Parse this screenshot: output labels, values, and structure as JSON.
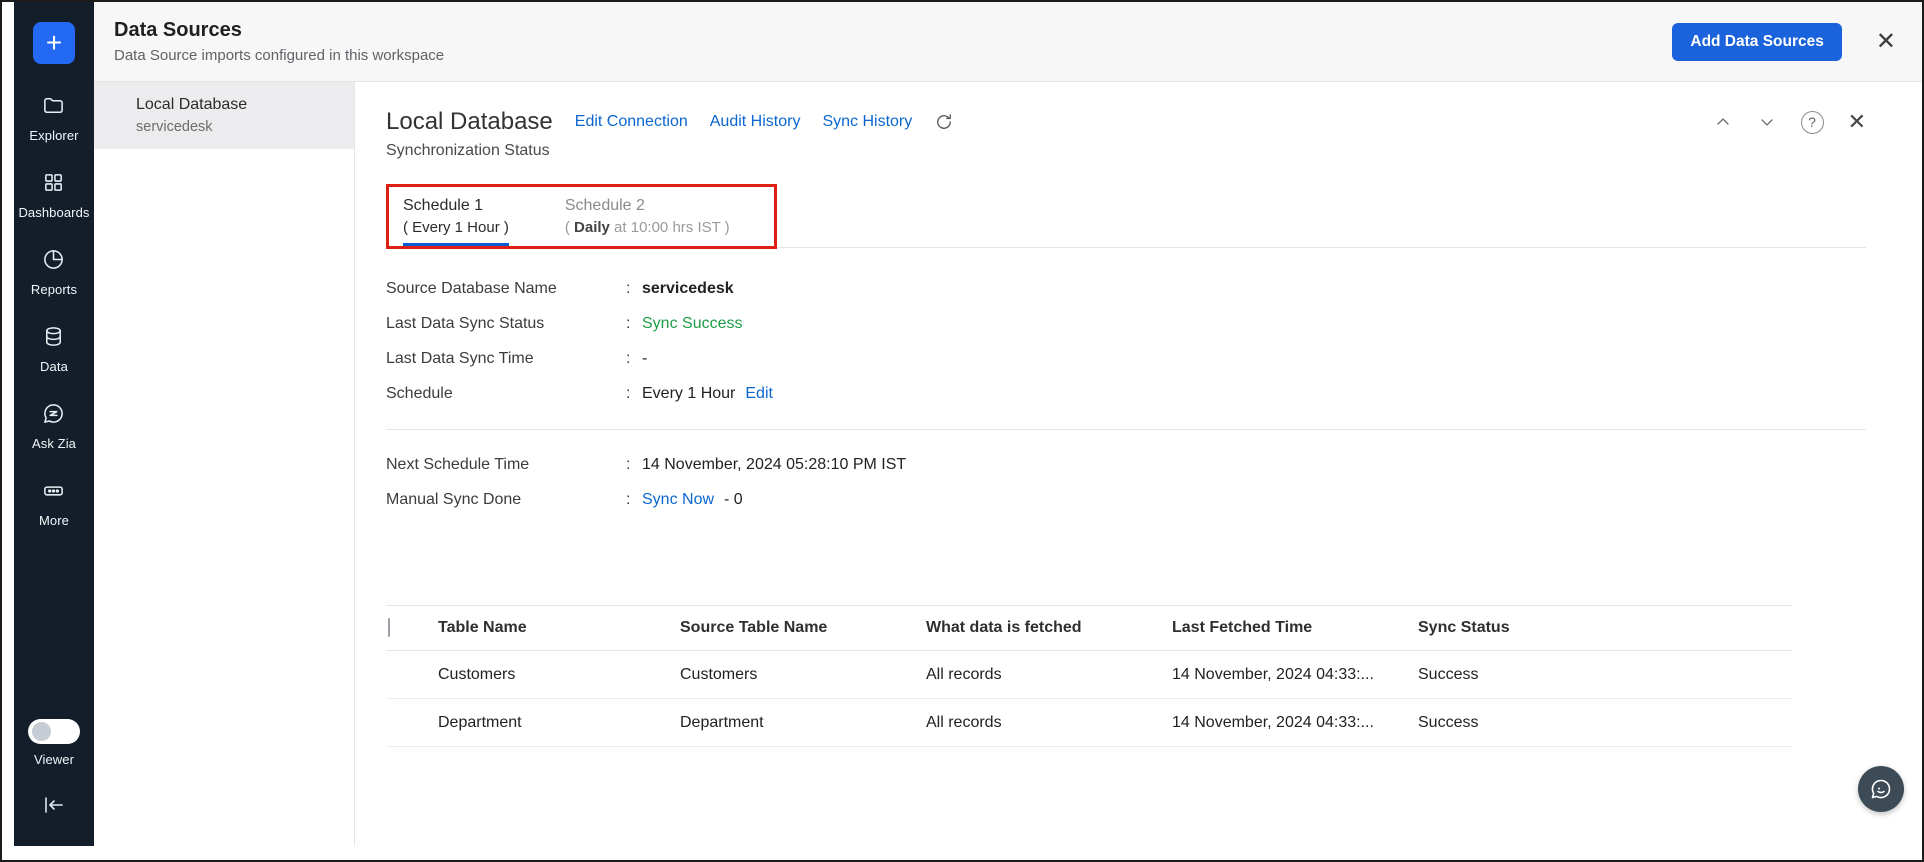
{
  "colors": {
    "accent_blue": "#1a63dc",
    "link_blue": "#0b66d0",
    "success_green": "#1f9d46",
    "annotation_red": "#dd1f14",
    "sidebar_bg": "#141e2a"
  },
  "sidebar": {
    "plus_label": "+",
    "items": [
      {
        "label": "Explorer",
        "icon": "folder-icon"
      },
      {
        "label": "Dashboards",
        "icon": "grid-icon"
      },
      {
        "label": "Reports",
        "icon": "pie-chart-icon"
      },
      {
        "label": "Data",
        "icon": "database-icon"
      },
      {
        "label": "Ask Zia",
        "icon": "zia-chat-icon"
      },
      {
        "label": "More",
        "icon": "ellipsis-icon"
      }
    ],
    "viewer_label": "Viewer"
  },
  "header": {
    "title": "Data Sources",
    "subtitle": "Data Source imports configured in this workspace",
    "add_button_label": "Add Data Sources",
    "close_icon": "✕"
  },
  "source_list": {
    "selected": {
      "name": "Local Database",
      "sub": "servicedesk"
    }
  },
  "main": {
    "title": "Local Database",
    "links": [
      "Edit Connection",
      "Audit History",
      "Sync History"
    ],
    "section_subtitle": "Synchronization Status",
    "help_icon": "?",
    "close_icon": "✕",
    "tabs": {
      "tab1": {
        "title": "Schedule 1",
        "sub": "( Every 1 Hour )"
      },
      "tab2": {
        "title": "Schedule 2",
        "sub_prefix": "( ",
        "sub_bold": "Daily",
        "sub_rest": " at 10:00 hrs IST )"
      }
    },
    "fields": {
      "colon": ":",
      "source_db": {
        "label": "Source Database Name",
        "value": "servicedesk"
      },
      "sync_status": {
        "label": "Last Data Sync Status",
        "value": "Sync Success"
      },
      "sync_time": {
        "label": "Last Data Sync Time",
        "value": "-"
      },
      "schedule": {
        "label": "Schedule",
        "value": "Every 1 Hour",
        "edit_link": "Edit"
      },
      "next_schedule": {
        "label": "Next Schedule Time",
        "value": "14 November, 2024 05:28:10 PM IST"
      },
      "manual_sync": {
        "label": "Manual Sync Done",
        "link": "Sync Now",
        "value": "- 0"
      }
    },
    "table": {
      "columns": [
        "Table Name",
        "Source Table Name",
        "What data is fetched",
        "Last Fetched Time",
        "Sync Status"
      ],
      "rows": [
        {
          "table_name": "Customers",
          "source_table": "Customers",
          "fetched": "All records",
          "last_fetched": "14 November, 2024 04:33:...",
          "status": "Success"
        },
        {
          "table_name": "Department",
          "source_table": "Department",
          "fetched": "All records",
          "last_fetched": "14 November, 2024 04:33:...",
          "status": "Success"
        }
      ]
    }
  }
}
